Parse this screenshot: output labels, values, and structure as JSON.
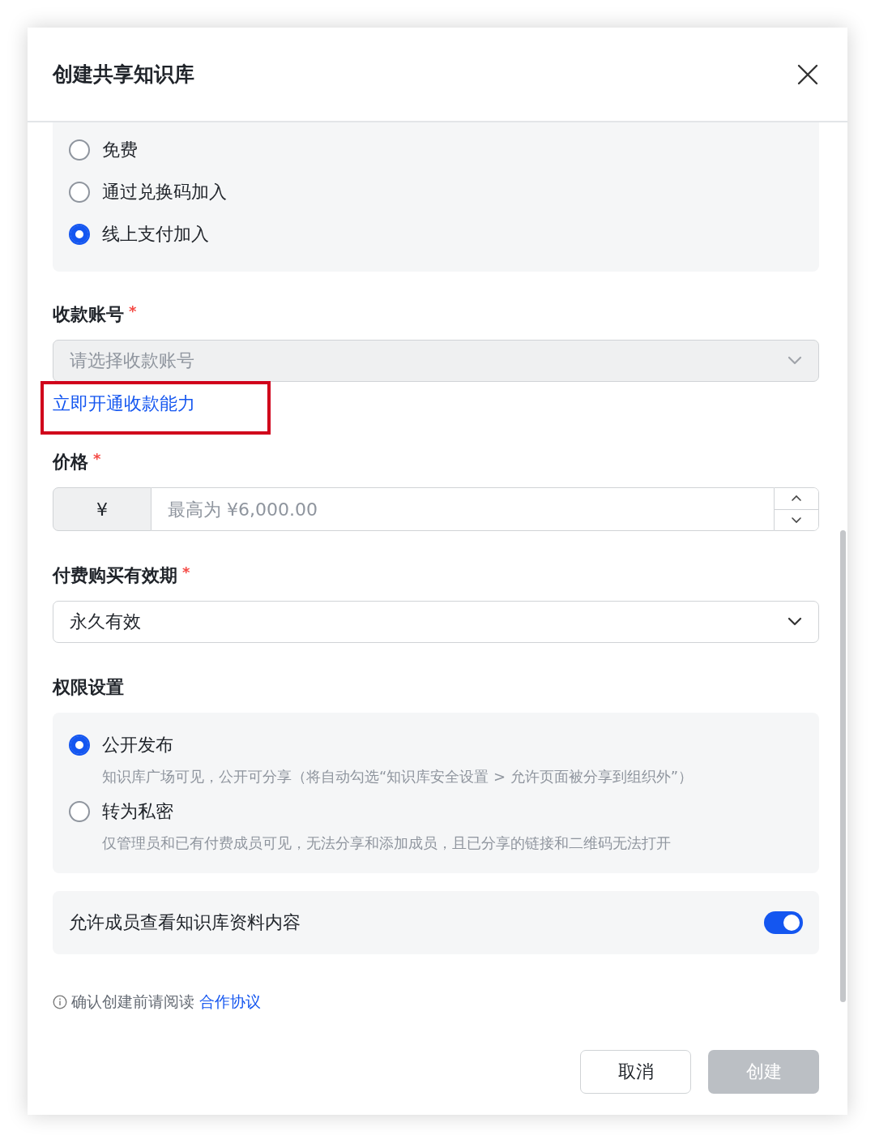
{
  "dialog": {
    "title": "创建共享知识库"
  },
  "join_options": [
    {
      "label": "免费",
      "selected": false
    },
    {
      "label": "通过兑换码加入",
      "selected": false
    },
    {
      "label": "线上支付加入",
      "selected": true
    }
  ],
  "account": {
    "label": "收款账号",
    "required_mark": "*",
    "placeholder": "请选择收款账号",
    "disabled": true,
    "link": "立即开通收款能力",
    "highlighted": true
  },
  "price": {
    "label": "价格",
    "required_mark": "*",
    "prefix": "¥",
    "placeholder": "最高为 ¥6,000.00"
  },
  "validity": {
    "label": "付费购买有效期",
    "required_mark": "*",
    "value": "永久有效"
  },
  "permissions": {
    "label": "权限设置",
    "options": [
      {
        "label": "公开发布",
        "description": "知识库广场可见，公开可分享（将自动勾选“知识库安全设置 > 允许页面被分享到组织外”）",
        "selected": true
      },
      {
        "label": "转为私密",
        "description": "仅管理员和已有付费成员可见，无法分享和添加成员，且已分享的链接和二维码无法打开",
        "selected": false
      }
    ]
  },
  "member_view": {
    "label": "允许成员查看知识库资料内容",
    "on": true
  },
  "notice": {
    "text": "确认创建前请阅读",
    "link": "合作协议"
  },
  "buttons": [
    {
      "label": "取消",
      "kind": "secondary",
      "disabled": false
    },
    {
      "label": "创建",
      "kind": "primary",
      "disabled": true
    }
  ]
}
